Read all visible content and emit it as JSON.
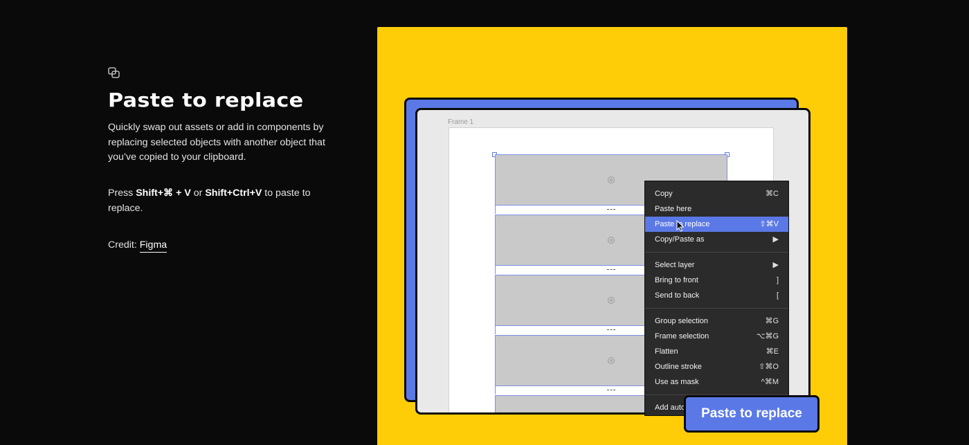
{
  "feature": {
    "icon": "paste-layers-icon",
    "title": "Paste to replace",
    "description": "Quickly swap out assets or add in components by replacing selected objects with another object that you’ve copied to your clipboard.",
    "shortcut": {
      "prefix": "Press ",
      "mac_keys": "Shift+⌘ + V",
      "middle": " or ",
      "win_keys": "Shift+Ctrl+V",
      "suffix": " to paste to replace."
    },
    "credit_label": "Credit: ",
    "credit_link": "Figma"
  },
  "illustration": {
    "colors": {
      "background": "#fecd07",
      "accent": "#5b79e6",
      "menu": "#2b2b2b"
    },
    "frame_label": "Frame 1",
    "context_menu": {
      "groups": [
        [
          {
            "label": "Copy",
            "shortcut": "⌘C"
          },
          {
            "label": "Paste here",
            "shortcut": ""
          },
          {
            "label": "Paste to replace",
            "shortcut": "⇧⌘V",
            "highlighted": true
          },
          {
            "label": "Copy/Paste as",
            "shortcut": "▶"
          }
        ],
        [
          {
            "label": "Select layer",
            "shortcut": "▶"
          },
          {
            "label": "Bring to front",
            "shortcut": "]"
          },
          {
            "label": "Send to back",
            "shortcut": "["
          }
        ],
        [
          {
            "label": "Group selection",
            "shortcut": "⌘G"
          },
          {
            "label": "Frame selection",
            "shortcut": "⌥⌘G"
          },
          {
            "label": "Flatten",
            "shortcut": "⌘E"
          },
          {
            "label": "Outline stroke",
            "shortcut": "⇧⌘O"
          },
          {
            "label": "Use as mask",
            "shortcut": "^⌘M"
          }
        ],
        [
          {
            "label": "Add auto layout",
            "shortcut": ""
          }
        ]
      ]
    },
    "callout_label": "Paste to replace"
  }
}
